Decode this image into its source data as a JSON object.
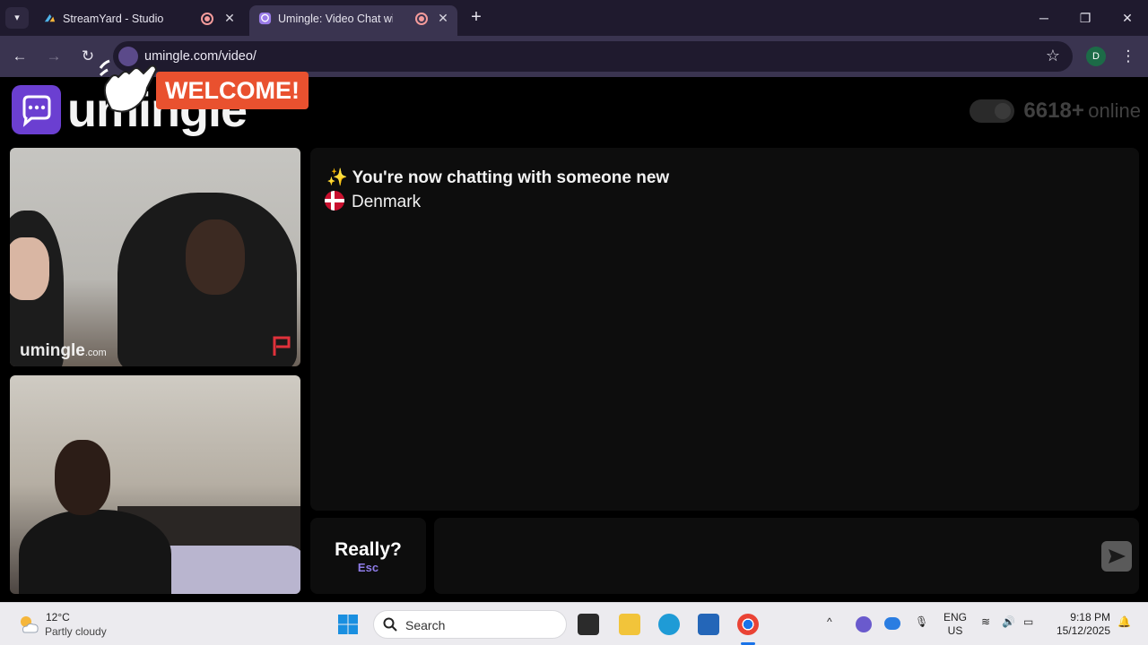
{
  "browser": {
    "tabs": [
      {
        "title": "StreamYard - Studio",
        "active": false
      },
      {
        "title": "Umingle: Video Chat with Str",
        "active": true
      }
    ],
    "url": "umingle.com/video/",
    "profile_initial": "D"
  },
  "page": {
    "logo_text": "umingle",
    "welcome_banner": "WELCOME!",
    "online_count": "6618+",
    "online_label": "online",
    "video_watermark": "umingle",
    "video_watermark_suffix": ".com",
    "chat_status": "✨ You're now chatting with someone new",
    "chat_country": "Denmark",
    "skip_label": "Really?",
    "skip_key": "Esc"
  },
  "taskbar": {
    "temperature": "12°C",
    "weather": "Partly cloudy",
    "search_label": "Search",
    "language_line1": "ENG",
    "language_line2": "US",
    "time": "9:18 PM",
    "date": "15/12/2025"
  },
  "colors": {
    "brand_purple": "#6b3fd1",
    "welcome_orange": "#e9512f",
    "esc_accent": "#8e7ce8"
  }
}
